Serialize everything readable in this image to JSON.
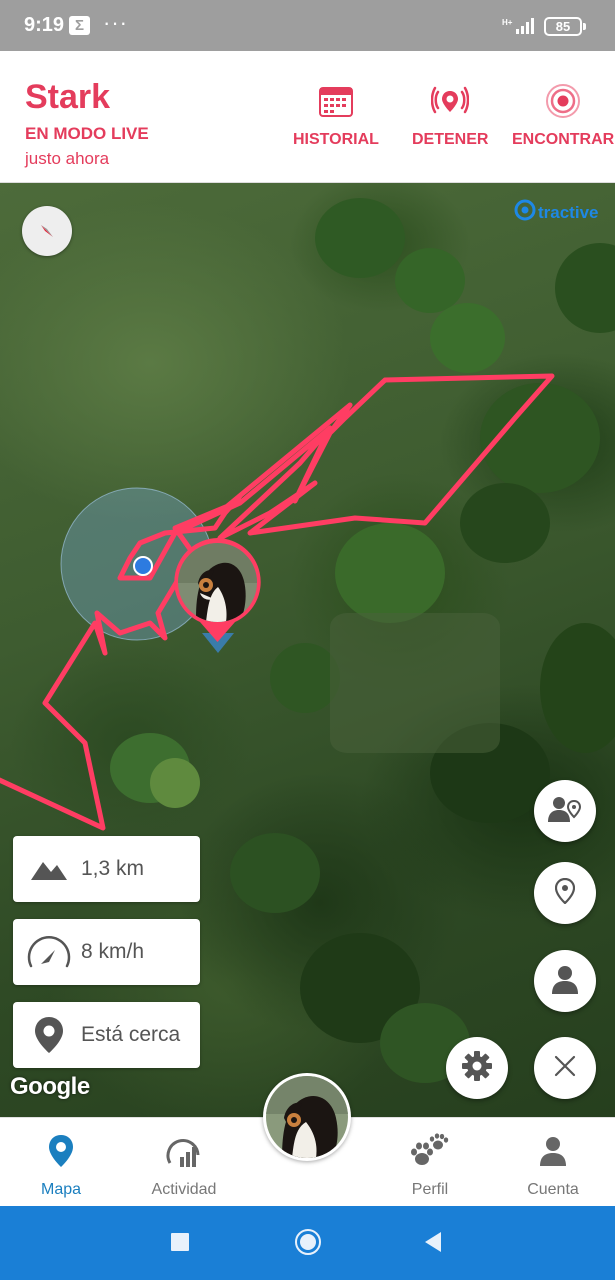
{
  "status_bar": {
    "time": "9:19",
    "notification_icon": "sigma-icon",
    "more": "···",
    "network": "H+",
    "battery": "85"
  },
  "header": {
    "pet_name": "Stark",
    "mode": "EN MODO LIVE",
    "last_update": "justo ahora",
    "actions": [
      {
        "label": "HISTORIAL",
        "icon": "calendar-icon"
      },
      {
        "label": "DETENER",
        "icon": "live-stop-icon"
      },
      {
        "label": "ENCONTRAR",
        "icon": "find-target-icon"
      }
    ]
  },
  "map": {
    "brand": "tractive",
    "attribution": "Google",
    "track_color": "#ff3d63",
    "info_cards": [
      {
        "icon": "mountain-icon",
        "value": "1,3 km"
      },
      {
        "icon": "speedometer-icon",
        "value": "8 km/h"
      },
      {
        "icon": "location-pin-icon",
        "value": "Está cerca"
      }
    ],
    "fabs": [
      "share-location-icon",
      "location-pin-icon",
      "person-icon",
      "gear-icon",
      "close-icon"
    ]
  },
  "bottom_nav": {
    "items": [
      {
        "label": "Mapa",
        "icon": "map-pin-icon",
        "active": true
      },
      {
        "label": "Actividad",
        "icon": "activity-icon",
        "active": false
      },
      {
        "label": "Perfil",
        "icon": "paw-icon",
        "active": false
      },
      {
        "label": "Cuenta",
        "icon": "account-icon",
        "active": false
      }
    ]
  },
  "colors": {
    "accent": "#e43c5c",
    "nav_active": "#1b7fbf",
    "system_nav": "#1a7fd6"
  }
}
